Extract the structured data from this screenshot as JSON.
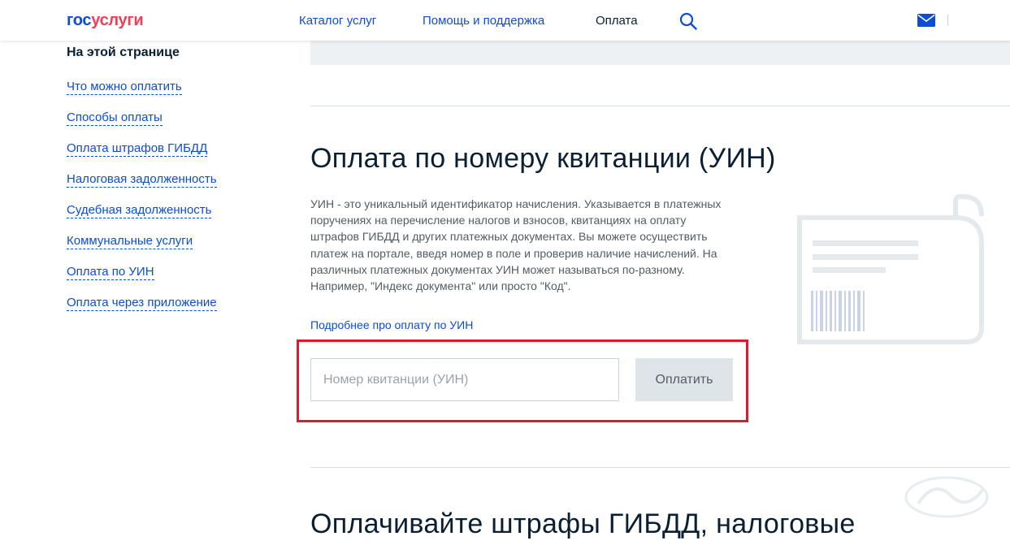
{
  "header": {
    "logo_part1": "гос",
    "logo_part2": "услуги",
    "nav": [
      "Каталог услуг",
      "Помощь и поддержка",
      "Оплата"
    ]
  },
  "sidebar": {
    "title": "На этой странице",
    "items": [
      "Что можно оплатить",
      "Способы оплаты",
      "Оплата штрафов ГИБДД",
      "Налоговая задолженность",
      "Судебная задолженность",
      "Коммунальные услуги",
      "Оплата по УИН",
      "Оплата через приложение"
    ]
  },
  "main": {
    "title": "Оплата по номеру квитанции (УИН)",
    "description": "УИН - это уникальный идентификатор начисления. Указывается в платежных поручениях на перечисление налогов и взносов, квитанциях на оплату штрафов ГИБДД и других платежных документах. Вы можете осуществить платеж на портале, введя номер в поле и проверив наличие начислений. На различных платежных документах УИН может называться по-разному. Например, \"Индекс документа\" или просто \"Код\".",
    "more_link": "Подробнее про оплату по УИН",
    "input_placeholder": "Номер квитанции (УИН)",
    "pay_button": "Оплатить",
    "next_title": "Оплачивайте штрафы ГИБДД, налоговые"
  },
  "colors": {
    "link": "#0d4cd3",
    "logo_red": "#ee3f58",
    "highlight": "#e0192f"
  },
  "icons": [
    "search-icon",
    "mail-icon",
    "receipt-illustration",
    "watermark-logo"
  ]
}
